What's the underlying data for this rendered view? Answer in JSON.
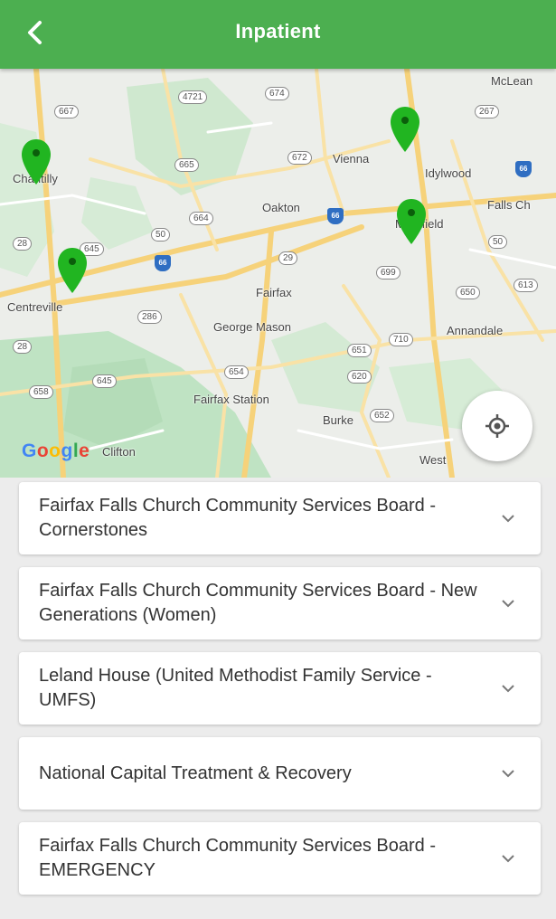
{
  "header": {
    "title": "Inpatient",
    "back_icon": "chevron-left-icon"
  },
  "map": {
    "attribution": "Google",
    "place_labels": [
      "McLean",
      "Chantilly",
      "Vienna",
      "Idylwood",
      "Falls Ch",
      "Oakton",
      "Merrifield",
      "Centreville",
      "Fairfax",
      "George Mason",
      "Annandale",
      "Fairfax Station",
      "Burke",
      "Clifton",
      "West"
    ],
    "route_shields": [
      "4721",
      "674",
      "667",
      "267",
      "665",
      "672",
      "664",
      "66",
      "50",
      "50",
      "28",
      "645",
      "29",
      "286",
      "699",
      "650",
      "613",
      "651",
      "710",
      "620",
      "652",
      "654",
      "645",
      "658",
      "28"
    ],
    "locate_icon": "my-location-icon"
  },
  "facilities": [
    {
      "name": "Fairfax Falls Church Community Services Board - Cornerstones"
    },
    {
      "name": "Fairfax Falls Church Community Services Board - New Generations (Women)"
    },
    {
      "name": "Leland House (United Methodist Family Service - UMFS)"
    },
    {
      "name": "National Capital Treatment & Recovery"
    },
    {
      "name": "Fairfax Falls Church Community Services Board - EMERGENCY"
    }
  ],
  "colors": {
    "header": "#4caf50",
    "pin": "#21b521",
    "background": "#ececec"
  }
}
